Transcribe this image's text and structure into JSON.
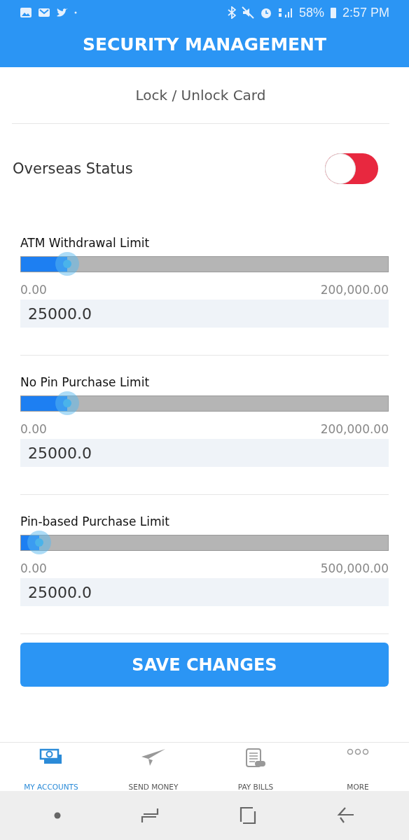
{
  "status_bar": {
    "battery": "58%",
    "time": "2:57 PM"
  },
  "header": {
    "title": "SECURITY MANAGEMENT"
  },
  "lock_row": {
    "label": "Lock / Unlock Card"
  },
  "overseas": {
    "label": "Overseas Status",
    "on": false
  },
  "limits": [
    {
      "label": "ATM Withdrawal Limit",
      "level": 0.125,
      "min": "0.00",
      "max": "200,000.00",
      "value": "25000.0"
    },
    {
      "label": "No Pin Purchase Limit",
      "level": 0.125,
      "min": "0.00",
      "max": "200,000.00",
      "value": "25000.0"
    },
    {
      "label": "Pin-based Purchase Limit",
      "level": 0.05,
      "min": "0.00",
      "max": "500,000.00",
      "value": "25000.0"
    }
  ],
  "save_button": "SAVE CHANGES",
  "bottom_nav": [
    {
      "label": "MY ACCOUNTS",
      "kind": "accounts",
      "selected": true
    },
    {
      "label": "SEND MONEY",
      "kind": "send",
      "selected": false
    },
    {
      "label": "PAY BILLS",
      "kind": "bills",
      "selected": false
    },
    {
      "label": "MORE",
      "kind": "more",
      "selected": false
    }
  ]
}
